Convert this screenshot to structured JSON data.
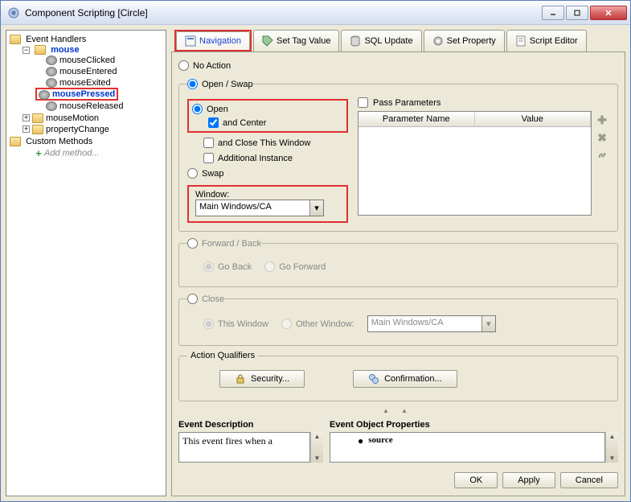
{
  "window": {
    "title": "Component Scripting [Circle]"
  },
  "tree": {
    "eventHandlers": "Event Handlers",
    "mouse": "mouse",
    "mouseClicked": "mouseClicked",
    "mouseEntered": "mouseEntered",
    "mouseExited": "mouseExited",
    "mousePressed": "mousePressed",
    "mouseReleased": "mouseReleased",
    "mouseMotion": "mouseMotion",
    "propertyChange": "propertyChange",
    "customMethods": "Custom Methods",
    "addMethod": "Add method..."
  },
  "tabs": {
    "navigation": "Navigation",
    "setTagValue": "Set Tag Value",
    "sqlUpdate": "SQL Update",
    "setProperty": "Set Property",
    "scriptEditor": "Script Editor"
  },
  "nav": {
    "noAction": "No Action",
    "openSwap": "Open / Swap",
    "open": "Open",
    "andCenter": "and Center",
    "andCloseThisWindow": "and Close This Window",
    "additionalInstance": "Additional Instance",
    "swap": "Swap",
    "windowLabel": "Window:",
    "windowValue": "Main Windows/CA",
    "passParameters": "Pass Parameters",
    "paramNameHeader": "Parameter Name",
    "valueHeader": "Value",
    "forwardBack": "Forward / Back",
    "goBack": "Go Back",
    "goForward": "Go Forward",
    "close": "Close",
    "thisWindow": "This Window",
    "otherWindow": "Other Window:",
    "otherWindowValue": "Main Windows/CA",
    "actionQualifiers": "Action Qualifiers",
    "security": "Security...",
    "confirmation": "Confirmation..."
  },
  "bottom": {
    "eventDescription": "Event Description",
    "eventDescText": "This event fires when a",
    "eventObjectProps": "Event Object Properties",
    "source": "source"
  },
  "buttons": {
    "ok": "OK",
    "apply": "Apply",
    "cancel": "Cancel"
  }
}
